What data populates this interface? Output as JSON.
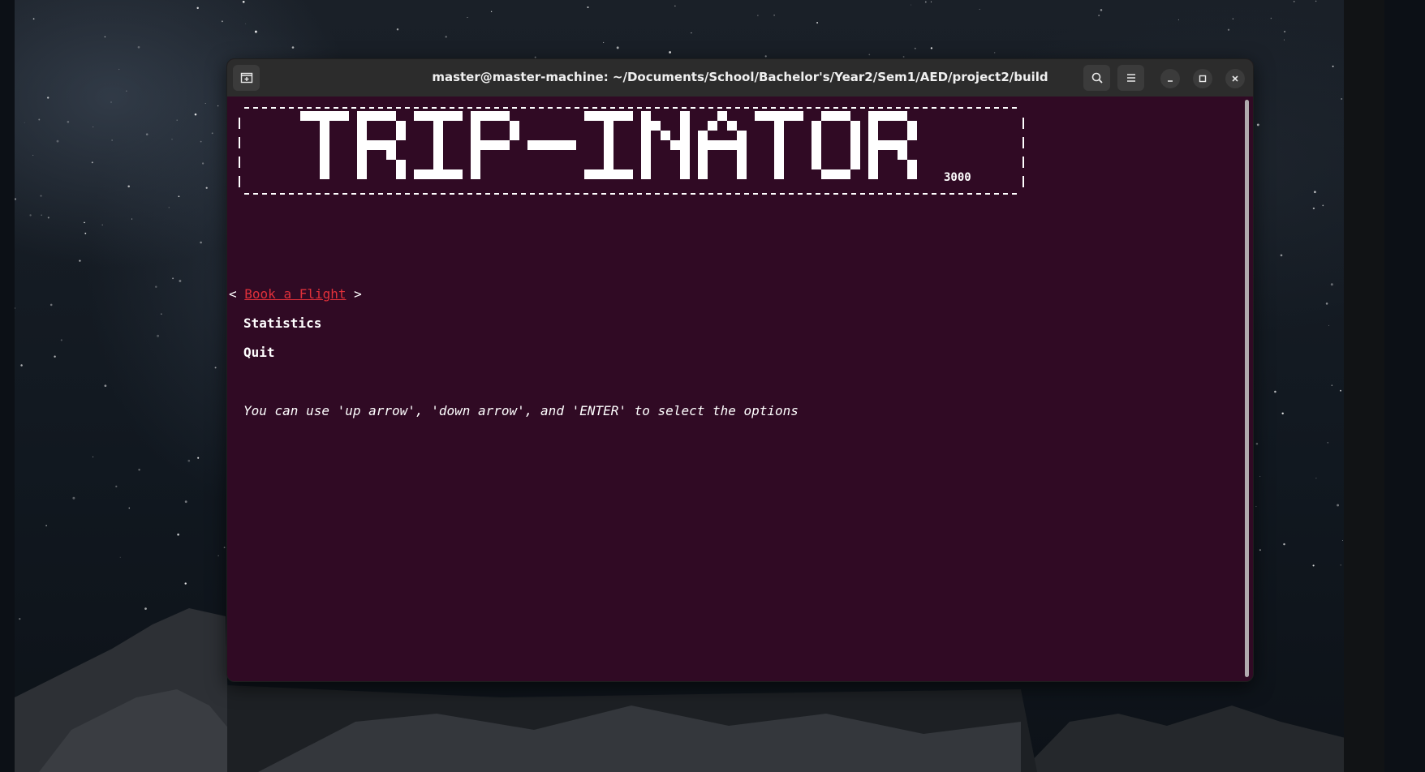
{
  "window": {
    "title": "master@master-machine: ~/Documents/School/Bachelor's/Year2/Sem1/AED/project2/build",
    "buttons": {
      "new_tab_icon": "new-tab-icon",
      "search_icon": "search-icon",
      "menu_icon": "hamburger-menu-icon",
      "minimize_icon": "minimize-icon",
      "maximize_icon": "maximize-icon",
      "close_icon": "close-icon"
    }
  },
  "terminal": {
    "banner": {
      "logo_text": "TRIP-INATOR",
      "subtitle": "3000"
    },
    "menu": {
      "selected_left_marker": "<",
      "selected_right_marker": ">",
      "items": [
        {
          "label": "Book a Flight",
          "selected": true
        },
        {
          "label": "Statistics",
          "selected": false
        },
        {
          "label": "Quit",
          "selected": false
        }
      ]
    },
    "hint": "You can use 'up arrow', 'down arrow', and 'ENTER' to select the options"
  },
  "colors": {
    "terminal_bg": "#300a24",
    "titlebar_bg": "#2c2c2c",
    "selected_item": "#e0303a",
    "text": "#ffffff"
  }
}
